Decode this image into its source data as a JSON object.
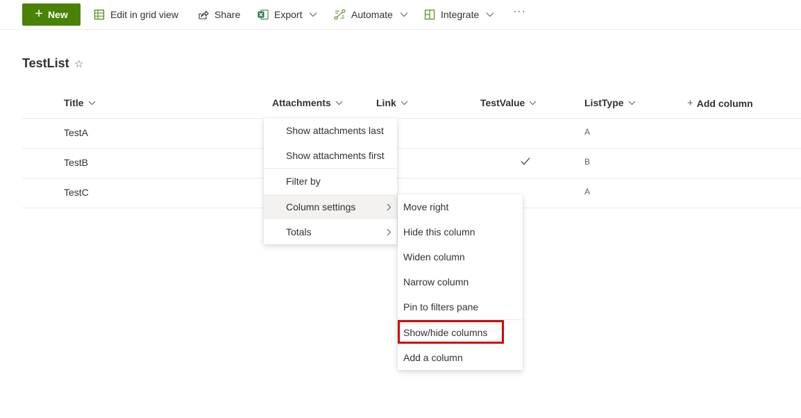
{
  "toolbar": {
    "new_label": "New",
    "edit_grid_label": "Edit in grid view",
    "share_label": "Share",
    "export_label": "Export",
    "automate_label": "Automate",
    "integrate_label": "Integrate",
    "more_label": "···"
  },
  "list": {
    "title": "TestList",
    "star_glyph": "☆"
  },
  "columns": {
    "title": "Title",
    "attachments": "Attachments",
    "link": "Link",
    "testvalue": "TestValue",
    "listtype": "ListType",
    "add_column": "Add column",
    "add_plus": "+"
  },
  "rows": [
    {
      "title": "TestA",
      "testvalue_checked": false,
      "listtype": "A"
    },
    {
      "title": "TestB",
      "testvalue_checked": true,
      "listtype": "B"
    },
    {
      "title": "TestC",
      "testvalue_checked": false,
      "listtype": "A"
    }
  ],
  "column_menu": {
    "items": [
      {
        "label": "Show attachments last"
      },
      {
        "label": "Show attachments first"
      },
      {
        "label": "Filter by"
      },
      {
        "label": "Column settings",
        "submenu": true,
        "active": true
      },
      {
        "label": "Totals",
        "submenu": true
      }
    ]
  },
  "settings_submenu": {
    "items": [
      {
        "label": "Move right"
      },
      {
        "label": "Hide this column"
      },
      {
        "label": "Widen column"
      },
      {
        "label": "Narrow column"
      },
      {
        "label": "Pin to filters pane"
      },
      {
        "label": "Show/hide columns",
        "highlighted": true
      },
      {
        "label": "Add a column"
      }
    ]
  },
  "icons": {
    "new": "plus-icon",
    "edit_grid": "grid-icon",
    "share": "share-icon",
    "export": "excel-icon",
    "automate": "flow-icon",
    "integrate": "apps-icon",
    "star": "star-icon",
    "check": "checkmark-icon",
    "chevron": "chevron-down-icon",
    "submenu": "chevron-right-icon"
  },
  "colors": {
    "brand_green": "#498205",
    "excel_green": "#217346",
    "highlight_red": "#d40000",
    "text": "#323130"
  }
}
